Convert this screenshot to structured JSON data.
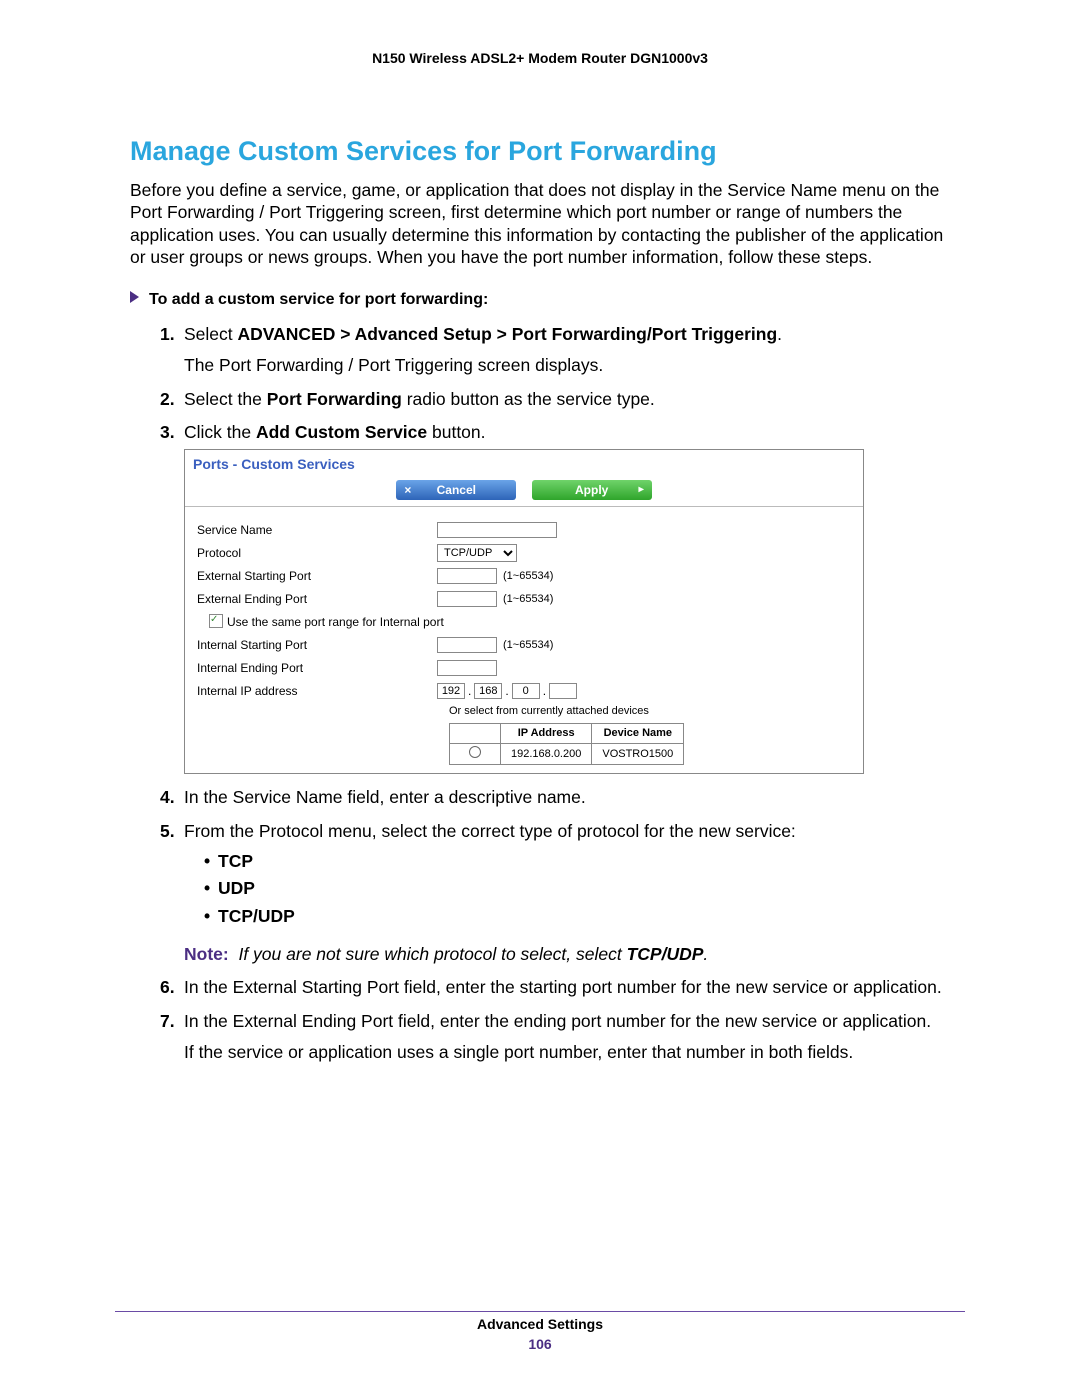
{
  "header": {
    "product": "N150 Wireless ADSL2+ Modem Router DGN1000v3"
  },
  "title": "Manage Custom Services for Port Forwarding",
  "intro": "Before you define a service, game, or application that does not display in the Service Name menu on the Port Forwarding / Port Triggering screen, first determine which port number or range of numbers the application uses. You can usually determine this information by contacting the publisher of the application or user groups or news groups. When you have the port number information, follow these steps.",
  "subheading": "To add a custom service for port forwarding:",
  "steps": {
    "s1a": "Select ",
    "s1b": "ADVANCED > Advanced Setup > Port Forwarding/Port Triggering",
    "s1c": ".",
    "s1sub": "The Port Forwarding / Port Triggering screen displays.",
    "s2a": "Select the ",
    "s2b": "Port Forwarding",
    "s2c": " radio button as the service type.",
    "s3a": "Click the ",
    "s3b": "Add Custom Service",
    "s3c": " button.",
    "s4": "In the Service Name field, enter a descriptive name.",
    "s5": "From the Protocol menu, select the correct type of protocol for the new service:",
    "s6": "In the External Starting Port field, enter the starting port number for the new service or application.",
    "s7": "In the External Ending Port field, enter the ending port number for the new service or application.",
    "s7sub": "If the service or application uses a single port number, enter that number in both fields."
  },
  "bullets": {
    "b1": "TCP",
    "b2": "UDP",
    "b3": "TCP/UDP"
  },
  "note": {
    "label": "Note:",
    "text_a": "If you are not sure which protocol to select, select ",
    "text_b": "TCP/UDP",
    "text_c": "."
  },
  "shot": {
    "title": "Ports - Custom Services",
    "cancel": "Cancel",
    "apply": "Apply",
    "labels": {
      "service_name": "Service Name",
      "protocol": "Protocol",
      "ext_start": "External Starting Port",
      "ext_end": "External Ending Port",
      "same_range": "Use the same port range for Internal port",
      "int_start": "Internal Starting Port",
      "int_end": "Internal Ending Port",
      "int_ip": "Internal IP address",
      "or_select": "Or select from currently attached devices"
    },
    "protocol_value": "TCP/UDP",
    "range_hint": "(1~65534)",
    "ip": {
      "o1": "192",
      "o2": "168",
      "o3": "0",
      "o4": ""
    },
    "dev_headers": {
      "ip": "IP Address",
      "name": "Device Name"
    },
    "dev_row": {
      "ip": "192.168.0.200",
      "name": "VOSTRO1500"
    }
  },
  "footer": {
    "section": "Advanced Settings",
    "page": "106"
  }
}
